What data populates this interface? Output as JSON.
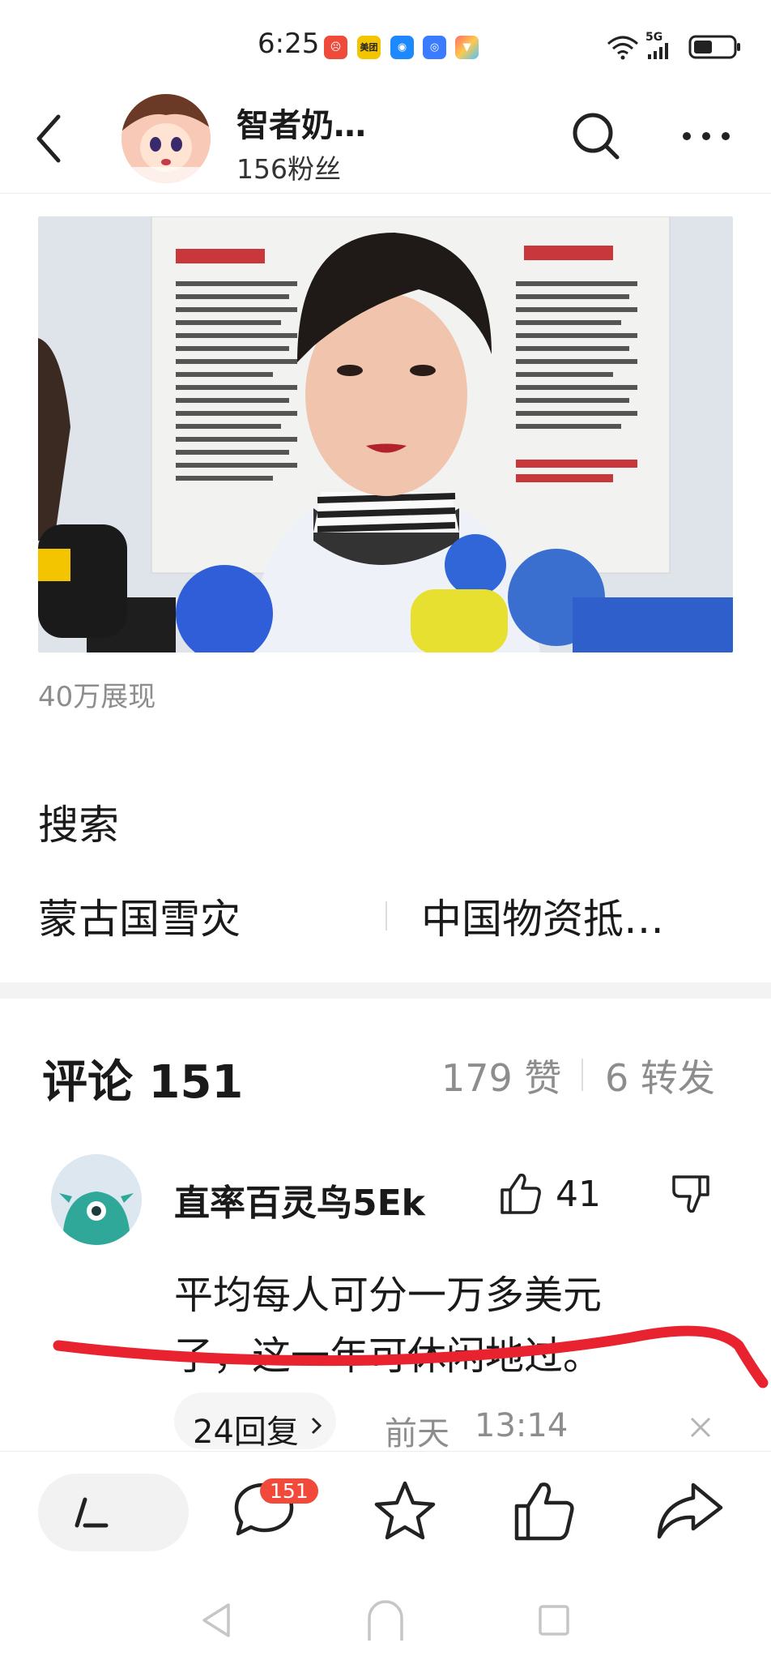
{
  "status_bar": {
    "time": "6:25",
    "notification_icons": [
      {
        "name": "app-red-icon",
        "color": "#ef4b3a"
      },
      {
        "name": "meituan-icon",
        "color": "#f2c500",
        "label": "美团"
      },
      {
        "name": "chat-blue-icon",
        "color": "#1e88ff"
      },
      {
        "name": "app-blue-icon",
        "color": "#3a7bff"
      },
      {
        "name": "app-colorful-icon",
        "color": "#ff6b6b"
      }
    ],
    "network": "5G"
  },
  "header": {
    "author_name": "智者奶…",
    "followers": "156粉丝"
  },
  "post": {
    "views": "40万展现"
  },
  "search": {
    "heading": "搜索",
    "suggestions": [
      "蒙古国雪灾",
      "中国物资抵…"
    ]
  },
  "comments": {
    "title": "评论 151",
    "likes": "179 赞",
    "reposts": "6 转发",
    "items": [
      {
        "author": "直率百灵鸟5Ek",
        "like_count": "41",
        "text_line1": "平均每人可分一万多美元",
        "text_line2": "了，这一年可休闲地过。",
        "replies": "24回复",
        "date": "前天",
        "time": "13:14"
      }
    ]
  },
  "bottom_bar": {
    "comment_badge": "151"
  },
  "colors": {
    "accent_red": "#f24a3a",
    "annotation_red": "#e8232f",
    "muted_gray": "#8d8d8d"
  }
}
